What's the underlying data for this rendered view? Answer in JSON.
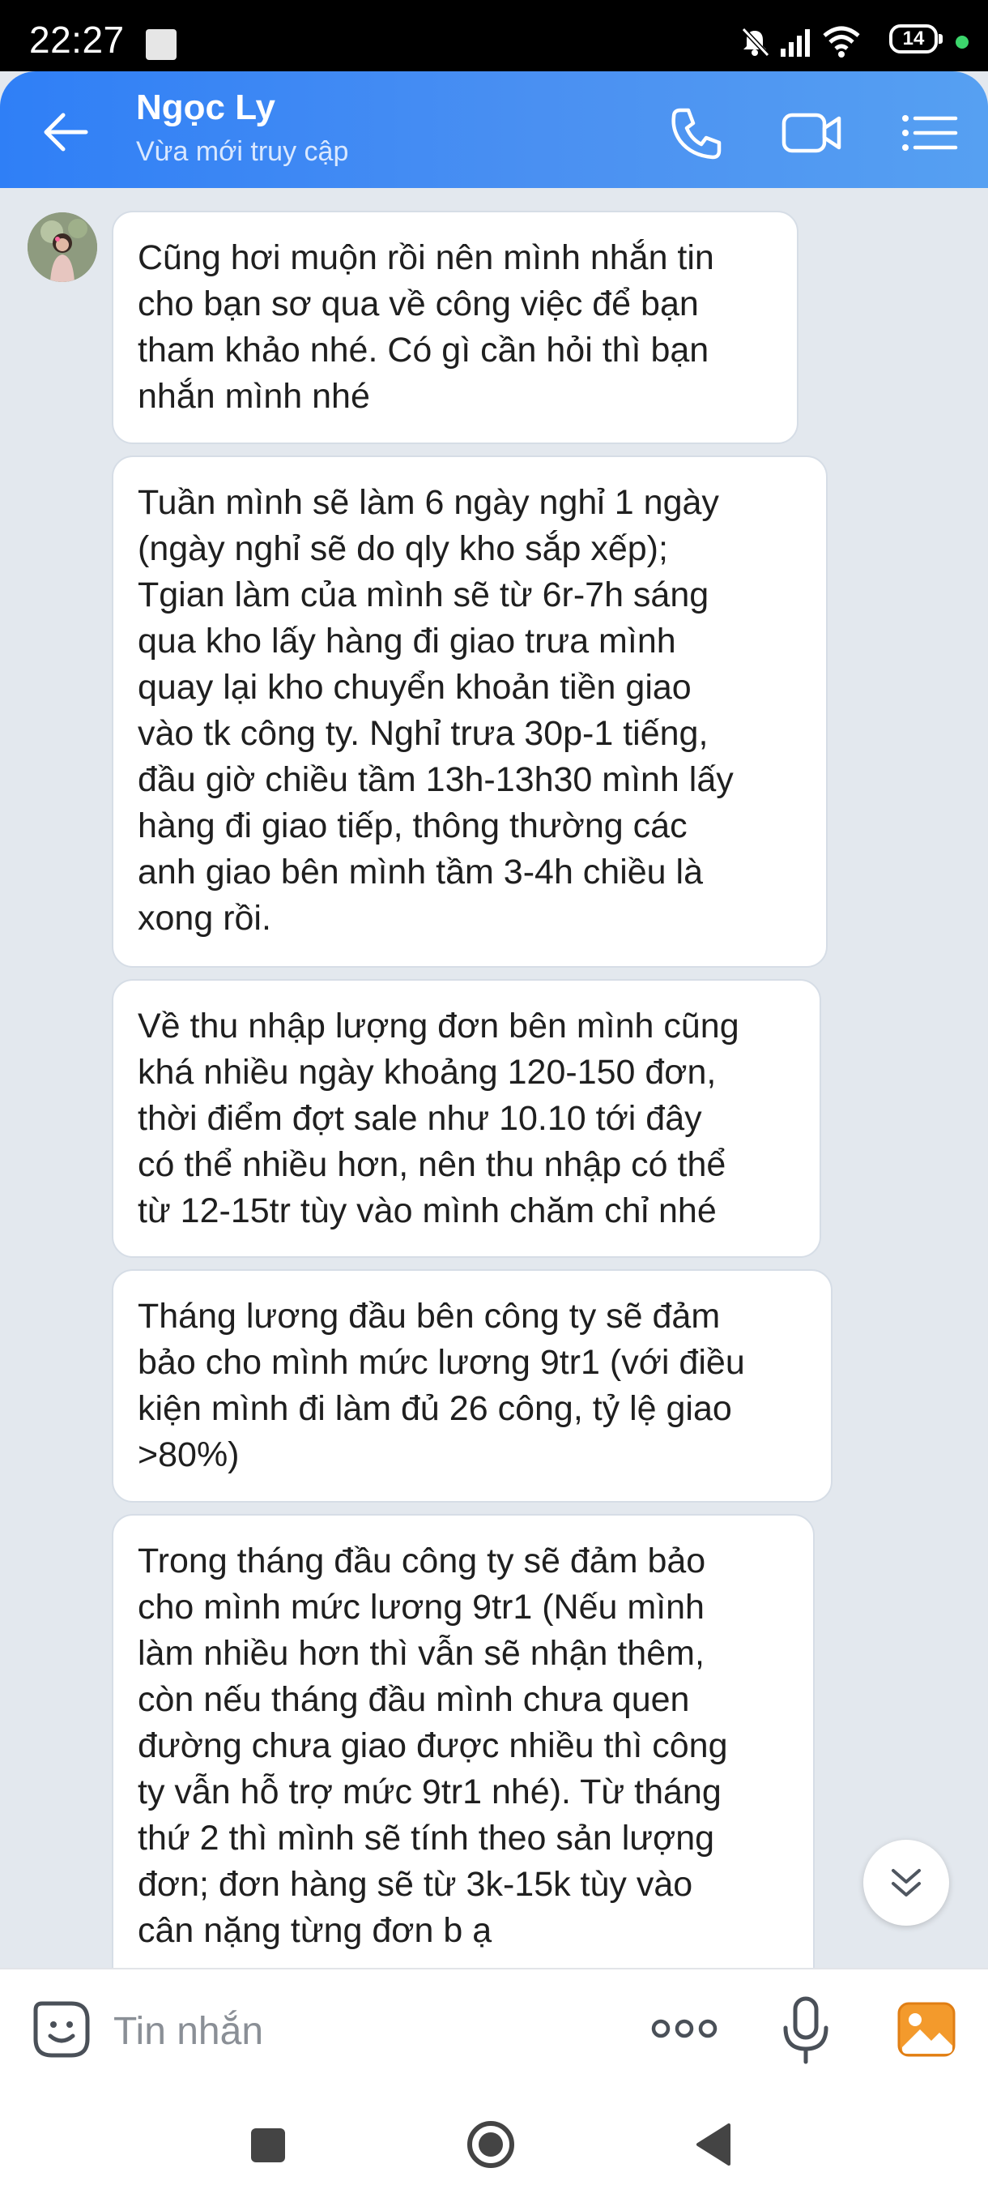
{
  "status_bar": {
    "time": "22:27",
    "battery": "14"
  },
  "header": {
    "contact_name": "Ngọc Ly",
    "contact_status": "Vừa mới truy cập"
  },
  "messages": [
    {
      "lines": [
        "Cũng hơi muộn rồi nên mình nhắn tin",
        "cho bạn sơ qua về công việc để bạn",
        "tham khảo nhé. Có gì cần hỏi thì bạn",
        "nhắn mình nhé"
      ]
    },
    {
      "lines": [
        "Tuần mình sẽ làm 6 ngày nghỉ 1 ngày",
        "(ngày nghỉ sẽ do qly kho sắp xếp);",
        "Tgian làm của mình sẽ từ 6r-7h sáng",
        "qua kho lấy hàng đi giao trưa mình",
        "quay lại kho chuyển khoản tiền giao",
        "vào tk công ty. Nghỉ trưa 30p-1 tiếng,",
        "đầu giờ chiều tầm 13h-13h30 mình lấy",
        "hàng đi giao tiếp, thông thường các",
        "anh giao bên mình tầm 3-4h chiều là",
        "xong rồi."
      ]
    },
    {
      "lines": [
        "Về thu nhập lượng đơn bên mình cũng",
        "khá nhiều ngày khoảng 120-150 đơn,",
        "thời điểm đợt sale như 10.10 tới đây",
        "có thể nhiều hơn, nên thu nhập có thể",
        "từ 12-15tr tùy vào mình chăm chỉ nhé"
      ]
    },
    {
      "lines": [
        "Tháng lương đầu bên công ty sẽ đảm",
        "bảo cho mình mức lương 9tr1 (với điều",
        "kiện mình đi làm đủ 26 công, tỷ lệ giao",
        ">80%)"
      ]
    },
    {
      "lines": [
        "Trong tháng đầu công ty sẽ đảm bảo",
        "cho mình mức lương 9tr1 (Nếu mình",
        "làm nhiều hơn thì vẫn sẽ nhận thêm,",
        "còn nếu tháng đầu mình chưa quen",
        "đường chưa giao được nhiều thì công",
        "ty vẫn hỗ trợ mức 9tr1 nhé). Từ tháng",
        "thứ 2 thì mình sẽ tính theo sản lượng",
        "đơn; đơn hàng sẽ từ 3k-15k tùy vào",
        "cân nặng từng đơn b ạ"
      ]
    }
  ],
  "composer": {
    "placeholder": "Tin nhắn"
  },
  "icons": {
    "back": "arrow-left-icon",
    "call": "phone-icon",
    "video": "video-camera-icon",
    "menu": "list-menu-icon",
    "emoji": "emoji-sticker-icon",
    "more": "more-dots-icon",
    "mic": "microphone-icon",
    "image": "image-gallery-icon",
    "scroll_down": "double-chevron-down-icon",
    "nav_recent": "square-icon",
    "nav_home": "circle-home-icon",
    "nav_back": "triangle-back-icon"
  },
  "colors": {
    "header_start": "#2f7ff6",
    "header_end": "#56a0f2",
    "chat_background": "#e3e8ee",
    "bubble": "#ffffff",
    "image_icon": "#f28c28"
  }
}
